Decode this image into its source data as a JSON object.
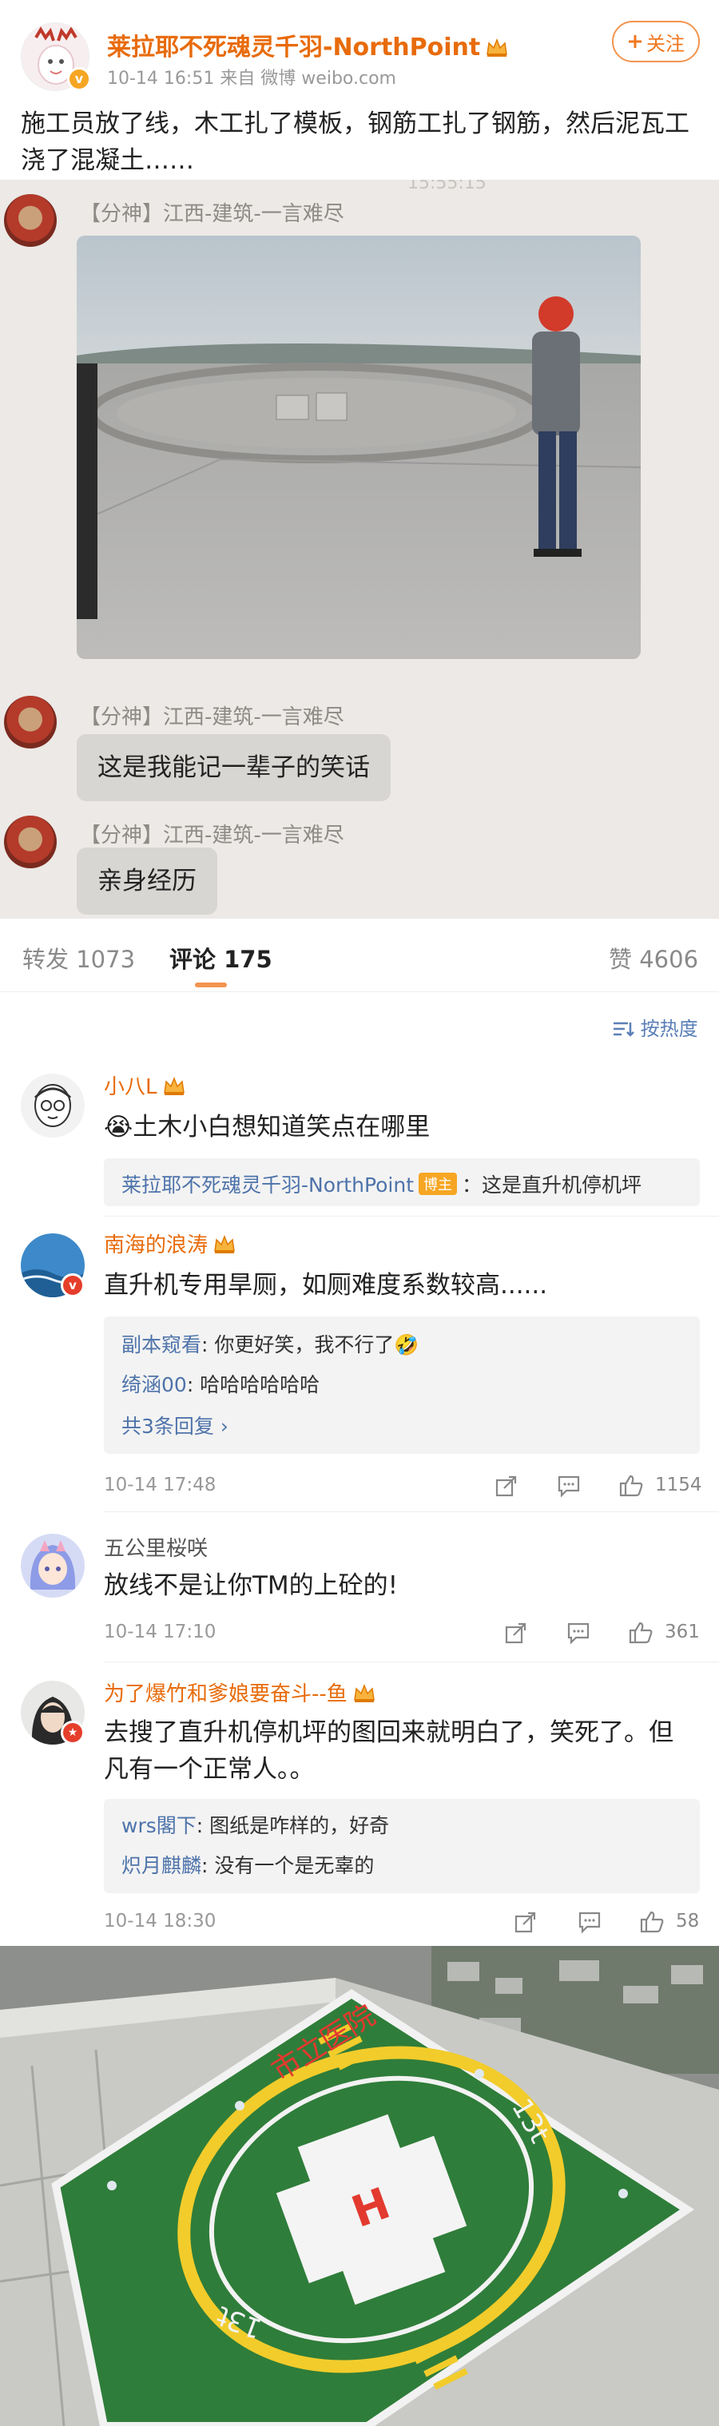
{
  "post": {
    "author": "莱拉耶不死魂灵千羽-NorthPoint",
    "meta": "10-14 16:51   来自 微博 weibo.com",
    "follow_label": "关注",
    "text": "施工员放了线，木工扎了模板，钢筋工扎了钢筋，然后泥瓦工浇了混凝土……"
  },
  "chat": {
    "time_fragment": "15:55:15",
    "messages": [
      {
        "sender": "【分神】江西-建筑-一言难尽",
        "type": "photo"
      },
      {
        "sender": "【分神】江西-建筑-一言难尽",
        "type": "text",
        "text": "这是我能记一辈子的笑话"
      },
      {
        "sender": "【分神】江西-建筑-一言难尽",
        "type": "text",
        "text": "亲身经历"
      }
    ]
  },
  "tabs": [
    {
      "label": "转发",
      "count": "1073"
    },
    {
      "label": "评论",
      "count": "175"
    },
    {
      "label": "赞",
      "count": "4606"
    }
  ],
  "sort_label": "按热度",
  "comments": [
    {
      "name": "小八L",
      "text": "😭土木小白想知道笑点在哪里",
      "replies": [
        {
          "user": "莱拉耶不死魂灵千羽-NorthPoint",
          "tag": "博主",
          "text": "：这是直升机停机坪"
        }
      ]
    },
    {
      "name": "南海的浪涛",
      "text": "直升机专用旱厕，如厕难度系数较高......",
      "replies": [
        {
          "user": "副本窥看",
          "text": ": 你更好笑，我不行了🤣"
        },
        {
          "user": "绮涵00",
          "text": ": 哈哈哈哈哈哈"
        }
      ],
      "more_replies": "共3条回复 ›",
      "time": "10-14 17:48",
      "likes": "1154"
    },
    {
      "name": "五公里桜咲",
      "text": "放线不是让你TM的上砼的!",
      "time": "10-14 17:10",
      "likes": "361"
    },
    {
      "name": "为了爆竹和爹娘要奋斗--鱼",
      "text": "去搜了直升机停机坪的图回来就明白了，笑死了。但凡有一个正常人。。",
      "replies": [
        {
          "user": "wrs閣下",
          "text": ": 图纸是咋样的，好奇"
        },
        {
          "user": "炽月麒麟",
          "text": ": 没有一个是无辜的"
        }
      ],
      "time": "10-14 18:30",
      "likes": "58"
    }
  ],
  "heli_photo": {
    "text_top": "市立医院",
    "text_side": "13t",
    "marker": "H"
  },
  "colors": {
    "accent": "#f29450",
    "name_orange": "#e86b0b",
    "link_blue": "#4e73aa",
    "chat_bg": "#ece9e6"
  }
}
